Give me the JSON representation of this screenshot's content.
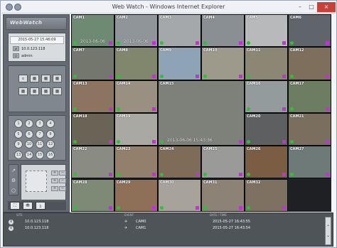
{
  "window": {
    "title": "Web Watch - Windows Internet Explorer",
    "min": "–",
    "max": "□",
    "close": "×"
  },
  "sidebar": {
    "logo": "WebWatch",
    "datetime": "2015-05-27 15:46:09",
    "ip": "10.0.123.118",
    "user": "admin",
    "split_buttons": [
      "▫",
      "▦",
      "▦",
      "▦",
      "▦",
      "▦",
      "▦",
      "▦"
    ],
    "numpad": [
      "1",
      "2",
      "3",
      "4",
      "5",
      "6",
      "7",
      "8",
      "9",
      "10",
      "11",
      "12",
      "13",
      "14",
      "15",
      "16"
    ],
    "ptz_left": [
      "↗",
      "⚙",
      "○"
    ],
    "ptz_right": [
      "+",
      "−",
      "+",
      "−",
      "+",
      "−"
    ],
    "tools": [
      "⛶",
      "⛃",
      "⤓"
    ]
  },
  "cameras": [
    {
      "label": "CAM1",
      "ts": "2013-06-06",
      "bg": "#6e8a72"
    },
    {
      "label": "CAM2",
      "ts": "2013-06-06",
      "bg": "#8f9599"
    },
    {
      "label": "CAM3",
      "ts": "",
      "bg": "#a5a8aa"
    },
    {
      "label": "CAM4",
      "ts": "",
      "bg": "#8a8f94"
    },
    {
      "label": "CAM5",
      "ts": "",
      "bg": "#b7b9ba"
    },
    {
      "label": "CAM6",
      "ts": "",
      "bg": "#5f656a"
    },
    {
      "label": "CAM7",
      "ts": "",
      "bg": "#73776e"
    },
    {
      "label": "CAM8",
      "ts": "",
      "bg": "#81876d"
    },
    {
      "label": "CAM9",
      "ts": "",
      "bg": "#8fa3b6"
    },
    {
      "label": "CAM10",
      "ts": "",
      "bg": "#9d9a8c"
    },
    {
      "label": "CAM11",
      "ts": "",
      "bg": "#8c8675"
    },
    {
      "label": "CAM12",
      "ts": "",
      "bg": "#7d6f5c"
    },
    {
      "label": "CAM13",
      "ts": "",
      "bg": "#8b7460"
    },
    {
      "label": "CAM14",
      "ts": "",
      "bg": "#9a9082"
    },
    {
      "label": "CAM15",
      "ts": "2013-06-06 15:43:36",
      "bg": "#7e8179"
    },
    {
      "label": "CAM16",
      "ts": "",
      "bg": "#939b9d"
    },
    {
      "label": "CAM17",
      "ts": "",
      "bg": "#6d7d62"
    },
    {
      "label": "CAM18",
      "ts": "",
      "bg": "#6a6456"
    },
    {
      "label": "CAM19",
      "ts": "",
      "bg": "#a9a8a2"
    },
    {
      "label": "CAM20",
      "ts": "",
      "bg": "#5e5f60"
    },
    {
      "label": "CAM21",
      "ts": "",
      "bg": "#7a6e5f"
    },
    {
      "label": "CAM22",
      "ts": "",
      "bg": "#8a8b82"
    },
    {
      "label": "CAM23",
      "ts": "",
      "bg": "#93806c"
    },
    {
      "label": "CAM24",
      "ts": "",
      "bg": "#7f6c58"
    },
    {
      "label": "CAM25",
      "ts": "",
      "bg": "#9a9a98"
    },
    {
      "label": "CAM26",
      "ts": "",
      "bg": "#7b5d44"
    },
    {
      "label": "CAM27",
      "ts": "",
      "bg": "#6e7a77"
    },
    {
      "label": "CAM28",
      "ts": "",
      "bg": "#7d8a76"
    },
    {
      "label": "CAM29",
      "ts": "",
      "bg": "#8e6f58"
    },
    {
      "label": "CAM30",
      "ts": "",
      "bg": "#a8a39a"
    },
    {
      "label": "CAM31",
      "ts": "",
      "bg": "#8c8376"
    },
    {
      "label": "CAM32",
      "ts": "",
      "bg": "#7e7162"
    }
  ],
  "log": {
    "headers": {
      "site": "SITE",
      "event": "EVENT",
      "datetime": "DATE / TIME"
    },
    "rows": [
      {
        "site": "10.0.123.118",
        "camera": "CAM0",
        "time": "2015-05-27 16:43:55"
      },
      {
        "site": "10.0.123.118",
        "camera": "CAM1",
        "time": "2015-05-27 16:43:54"
      }
    ],
    "scroll_up": "⌃",
    "scroll_down": "⌄"
  }
}
